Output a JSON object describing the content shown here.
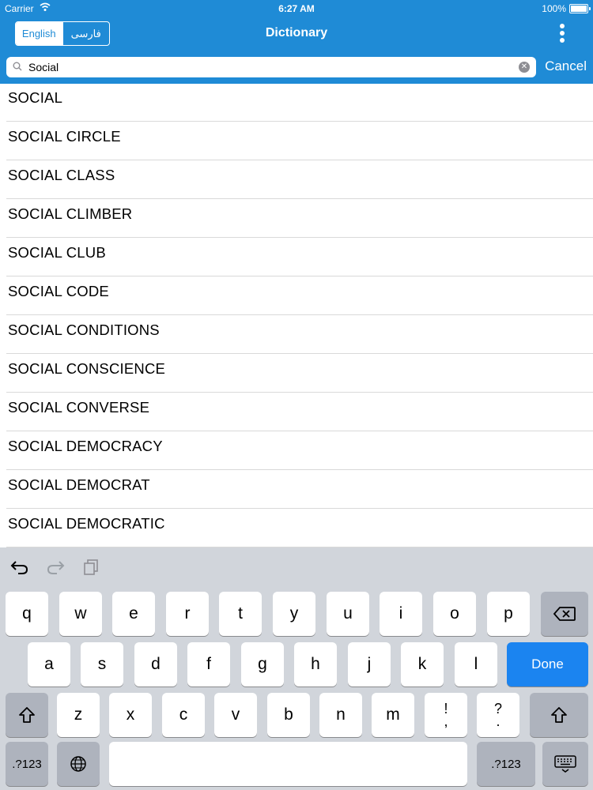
{
  "status_bar": {
    "carrier": "Carrier",
    "time": "6:27 AM",
    "battery": "100%"
  },
  "header": {
    "lang_active": "English",
    "lang_inactive": "فارسی",
    "title": "Dictionary"
  },
  "search": {
    "value": "Social",
    "cancel": "Cancel"
  },
  "results": [
    "SOCIAL",
    "SOCIAL CIRCLE",
    "SOCIAL CLASS",
    "SOCIAL CLIMBER",
    "SOCIAL CLUB",
    "SOCIAL CODE",
    "SOCIAL CONDITIONS",
    "SOCIAL CONSCIENCE",
    "SOCIAL CONVERSE",
    "SOCIAL DEMOCRACY",
    "SOCIAL DEMOCRAT",
    "SOCIAL DEMOCRATIC"
  ],
  "keyboard": {
    "row1": [
      "q",
      "w",
      "e",
      "r",
      "t",
      "y",
      "u",
      "i",
      "o",
      "p"
    ],
    "row2": [
      "a",
      "s",
      "d",
      "f",
      "g",
      "h",
      "j",
      "k",
      "l"
    ],
    "row3": [
      "z",
      "x",
      "c",
      "v",
      "b",
      "n",
      "m"
    ],
    "punct1_top": "!",
    "punct1_bottom": ",",
    "punct2_top": "?",
    "punct2_bottom": ".",
    "done": "Done",
    "numbers_left": ".?123",
    "numbers_right": ".?123"
  },
  "colors": {
    "header": "#1f8bd6",
    "done": "#1b84f0",
    "keyboard_bg": "#d1d5db"
  }
}
